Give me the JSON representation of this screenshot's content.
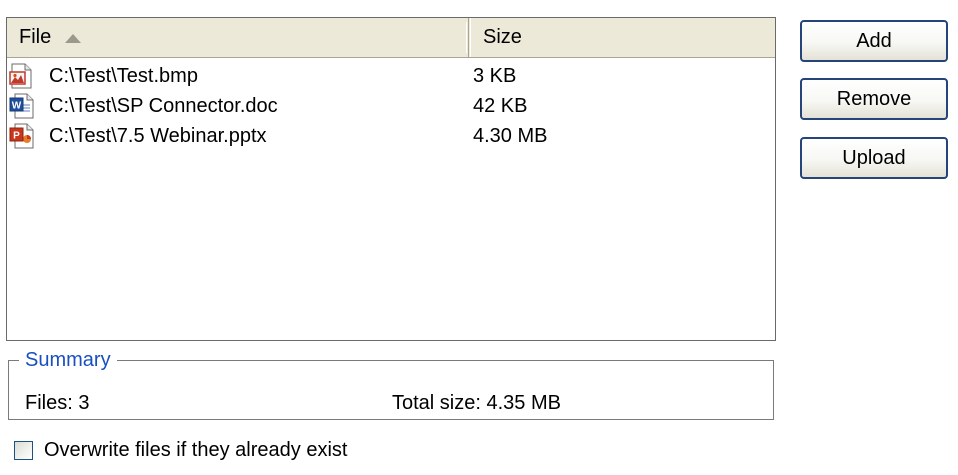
{
  "file_list": {
    "columns": {
      "file": "File",
      "size": "Size"
    },
    "sort": {
      "column": "File",
      "direction": "ascending"
    },
    "rows": [
      {
        "name": "C:\\Test\\Test.bmp",
        "size": "3 KB",
        "icon": "bmp-image-icon"
      },
      {
        "name": "C:\\Test\\SP Connector.doc",
        "size": "42 KB",
        "icon": "word-document-icon"
      },
      {
        "name": "C:\\Test\\7.5 Webinar.pptx",
        "size": "4.30 MB",
        "icon": "powerpoint-icon"
      }
    ]
  },
  "buttons": {
    "add": "Add",
    "remove": "Remove",
    "upload": "Upload"
  },
  "summary": {
    "legend": "Summary",
    "files": "Files: 3",
    "total_size": "Total size: 4.35 MB"
  },
  "overwrite": {
    "label": "Overwrite files if they already exist",
    "checked": false
  },
  "colors": {
    "header_bg": "#ece9d8",
    "button_border": "#24447a",
    "legend_text": "#1a4fbf"
  }
}
